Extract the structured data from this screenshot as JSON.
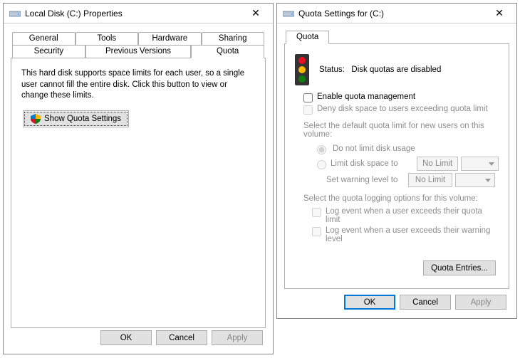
{
  "left": {
    "title": "Local Disk (C:) Properties",
    "tabs": {
      "general": "General",
      "tools": "Tools",
      "hardware": "Hardware",
      "sharing": "Sharing",
      "security": "Security",
      "previous": "Previous Versions",
      "quota": "Quota"
    },
    "desc": "This hard disk supports space limits for each user, so a single user cannot fill the entire disk. Click this button to view or change these limits.",
    "show_btn": "Show Quota Settings",
    "ok": "OK",
    "cancel": "Cancel",
    "apply": "Apply"
  },
  "right": {
    "title": "Quota Settings for  (C:)",
    "tab": "Quota",
    "status_label": "Status:",
    "status_value": "Disk quotas are disabled",
    "enable": "Enable quota management",
    "deny": "Deny disk space to users exceeding quota limit",
    "default_label": "Select the default quota limit for new users on this volume:",
    "no_limit_radio": "Do not limit disk usage",
    "limit_radio": "Limit disk space to",
    "warn_label": "Set warning level to",
    "no_limit_value": "No Limit",
    "log_label": "Select the quota logging options for this volume:",
    "log_quota": "Log event when a user exceeds their quota limit",
    "log_warn": "Log event when a user exceeds their warning level",
    "quota_entries": "Quota Entries...",
    "ok": "OK",
    "cancel": "Cancel",
    "apply": "Apply"
  }
}
